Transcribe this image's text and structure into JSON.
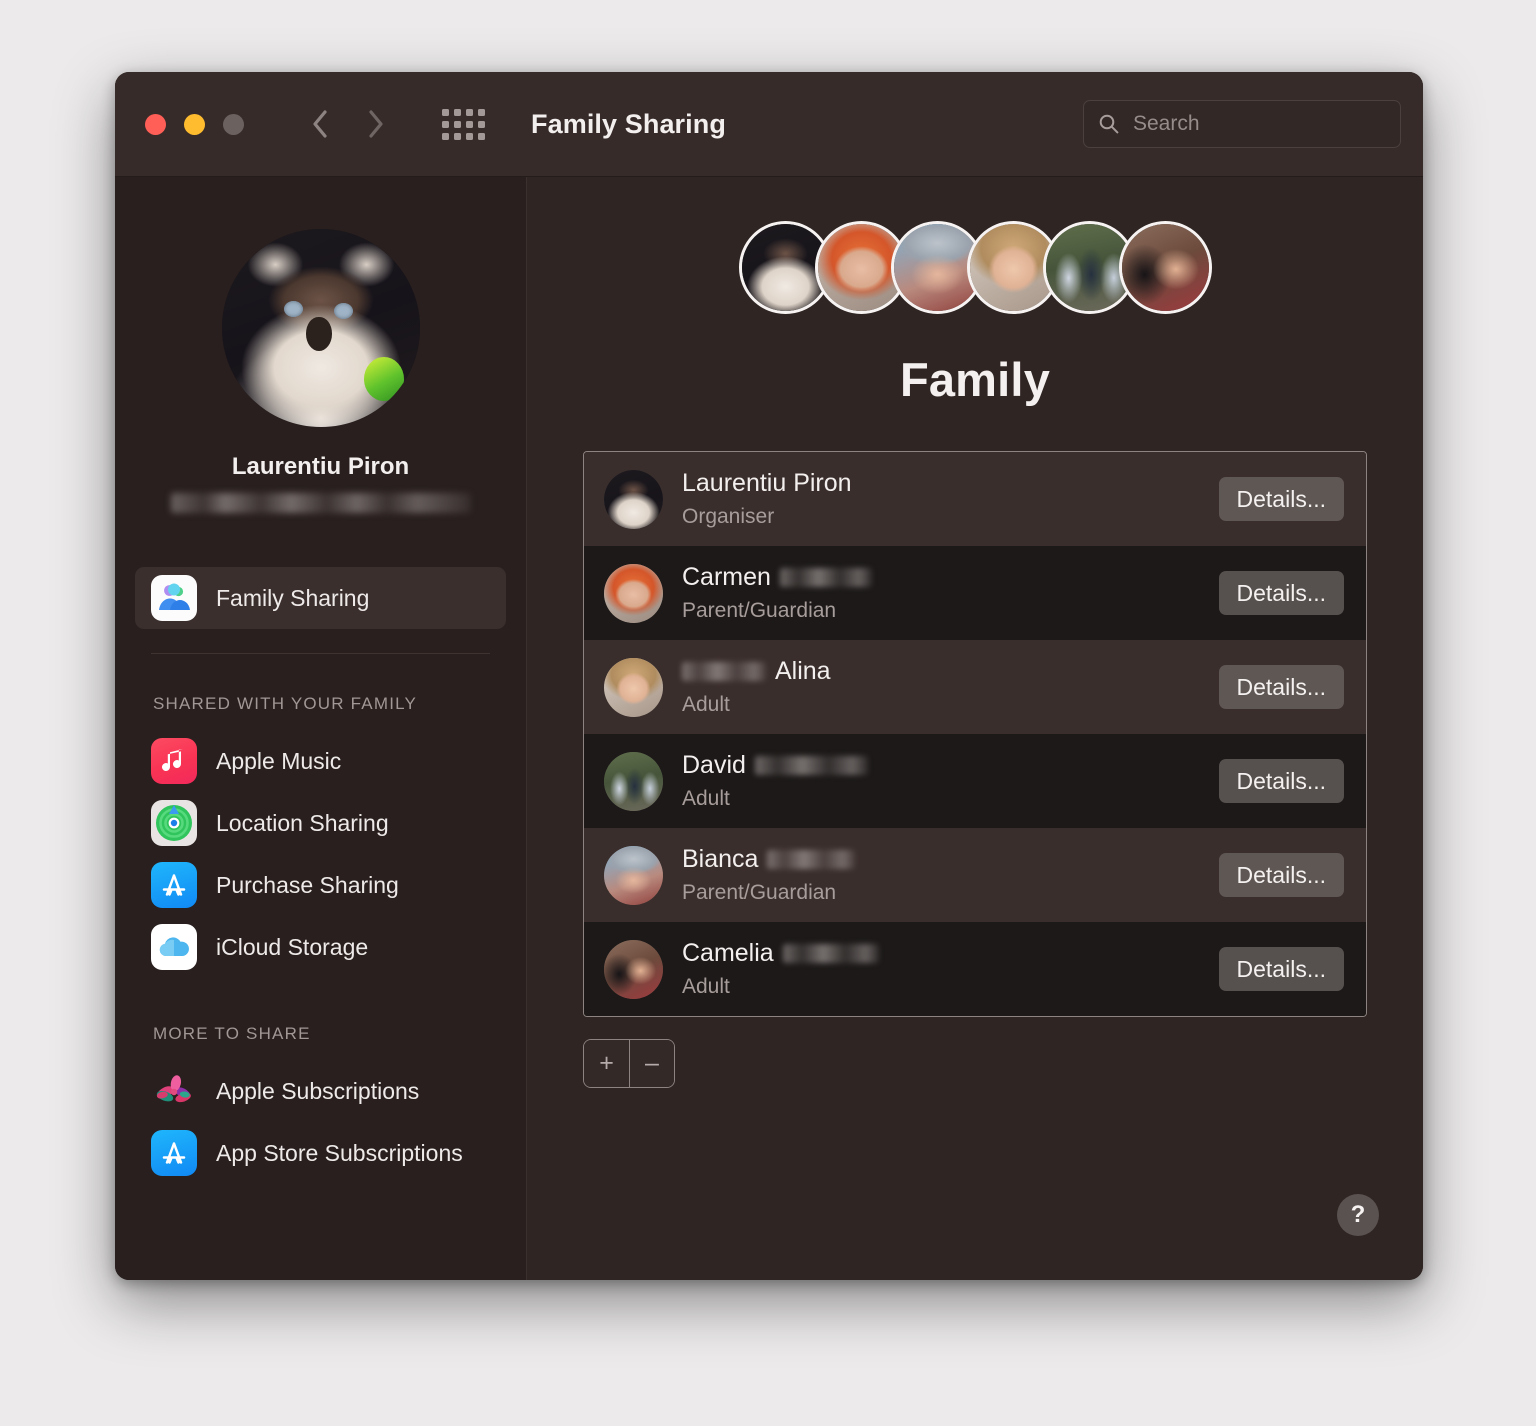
{
  "window": {
    "title": "Family Sharing",
    "traffic_lights": [
      "close",
      "minimize",
      "zoom"
    ],
    "back_label": "Back",
    "forward_label": "Forward",
    "grid_label": "Show All",
    "colors": {
      "close": "#ff5f56",
      "minimize": "#febc2e",
      "zoom": "#6b615e"
    }
  },
  "search": {
    "placeholder": "Search",
    "value": ""
  },
  "sidebar": {
    "account": {
      "name": "Laurentiu Piron",
      "email_redacted": true
    },
    "selected": {
      "label": "Family Sharing",
      "icon": "family-sharing-icon"
    },
    "sections": [
      {
        "title": "SHARED WITH YOUR FAMILY",
        "items": [
          {
            "label": "Apple Music",
            "icon": "apple-music-icon"
          },
          {
            "label": "Location Sharing",
            "icon": "find-my-icon"
          },
          {
            "label": "Purchase Sharing",
            "icon": "app-store-icon"
          },
          {
            "label": "iCloud Storage",
            "icon": "icloud-icon"
          }
        ]
      },
      {
        "title": "MORE TO SHARE",
        "items": [
          {
            "label": "Apple Subscriptions",
            "icon": "apple-subscriptions-icon"
          },
          {
            "label": "App Store Subscriptions",
            "icon": "app-store-icon"
          }
        ]
      }
    ]
  },
  "main": {
    "heading": "Family",
    "avatar_cluster": [
      "cat",
      "red-hair",
      "hat",
      "blonde",
      "group",
      "mother"
    ],
    "members": [
      {
        "first_name": "Laurentiu Piron",
        "surname_redacted": false,
        "role": "Organiser",
        "details_label": "Details...",
        "avatar": "cat"
      },
      {
        "first_name": "Carmen",
        "surname_redacted": true,
        "role": "Parent/Guardian",
        "details_label": "Details...",
        "avatar": "red-hair"
      },
      {
        "first_name": "Alina",
        "surname_redacted": true,
        "surname_first": true,
        "role": "Adult",
        "details_label": "Details...",
        "avatar": "blonde"
      },
      {
        "first_name": "David",
        "surname_redacted": true,
        "role": "Adult",
        "details_label": "Details...",
        "avatar": "group"
      },
      {
        "first_name": "Bianca",
        "surname_redacted": true,
        "role": "Parent/Guardian",
        "details_label": "Details...",
        "avatar": "hat"
      },
      {
        "first_name": "Camelia",
        "surname_redacted": true,
        "role": "Adult",
        "details_label": "Details...",
        "avatar": "mother"
      }
    ],
    "add_label": "+",
    "remove_label": "–",
    "help_label": "?"
  }
}
